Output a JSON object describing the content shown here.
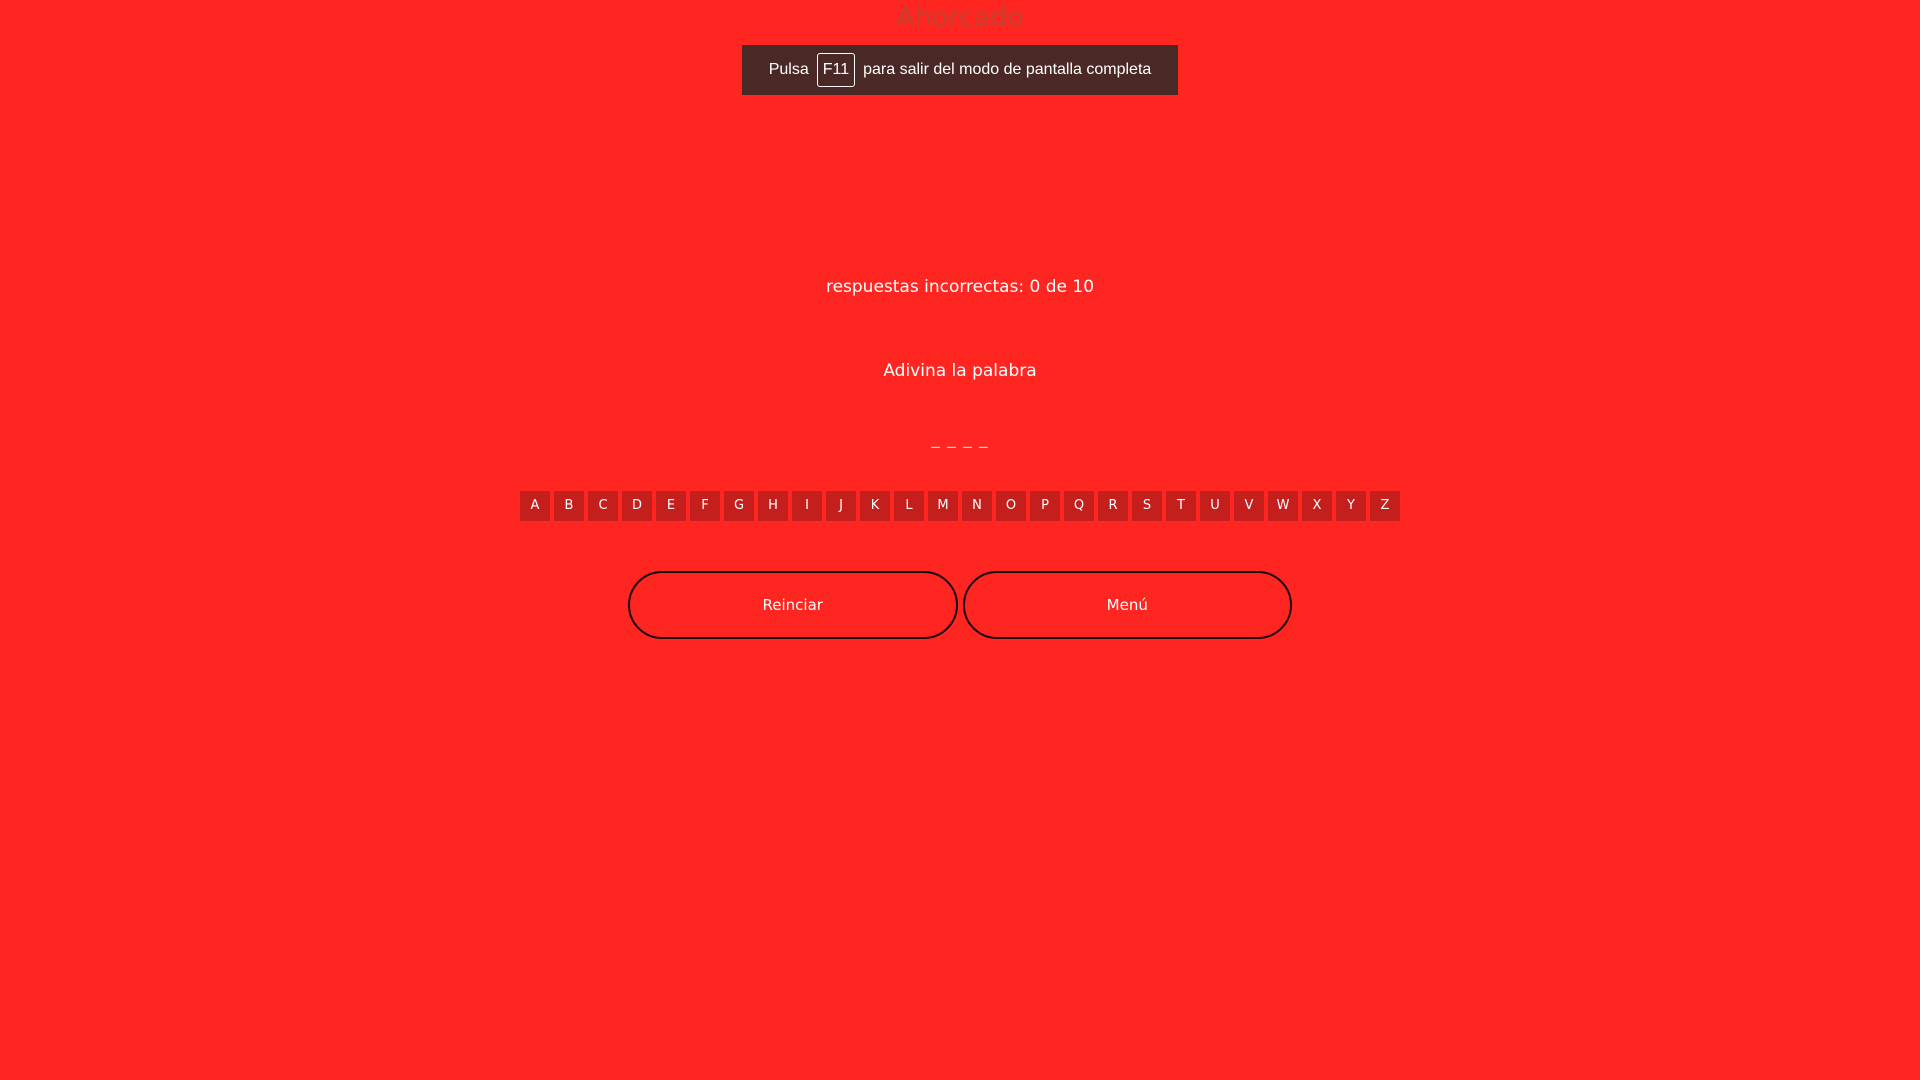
{
  "header": {
    "title": "Ahorcado"
  },
  "fullscreen_notice": {
    "prefix": "Pulsa",
    "key": "F11",
    "suffix": "para salir del modo de pantalla completa"
  },
  "game": {
    "wrong_answers": "respuestas incorrectas: 0 de 10",
    "prompt": "Adivina la palabra",
    "word_mask": "_ _ _ _"
  },
  "alphabet": [
    "A",
    "B",
    "C",
    "D",
    "E",
    "F",
    "G",
    "H",
    "I",
    "J",
    "K",
    "L",
    "M",
    "N",
    "O",
    "P",
    "Q",
    "R",
    "S",
    "T",
    "U",
    "V",
    "W",
    "X",
    "Y",
    "Z"
  ],
  "actions": {
    "restart_label": "Reinciar",
    "menu_label": "Menú"
  },
  "colors": {
    "background": "#ff2520",
    "letter_button": "#c41f1c",
    "notice_background": "#4a2826",
    "title": "#c2412f"
  }
}
